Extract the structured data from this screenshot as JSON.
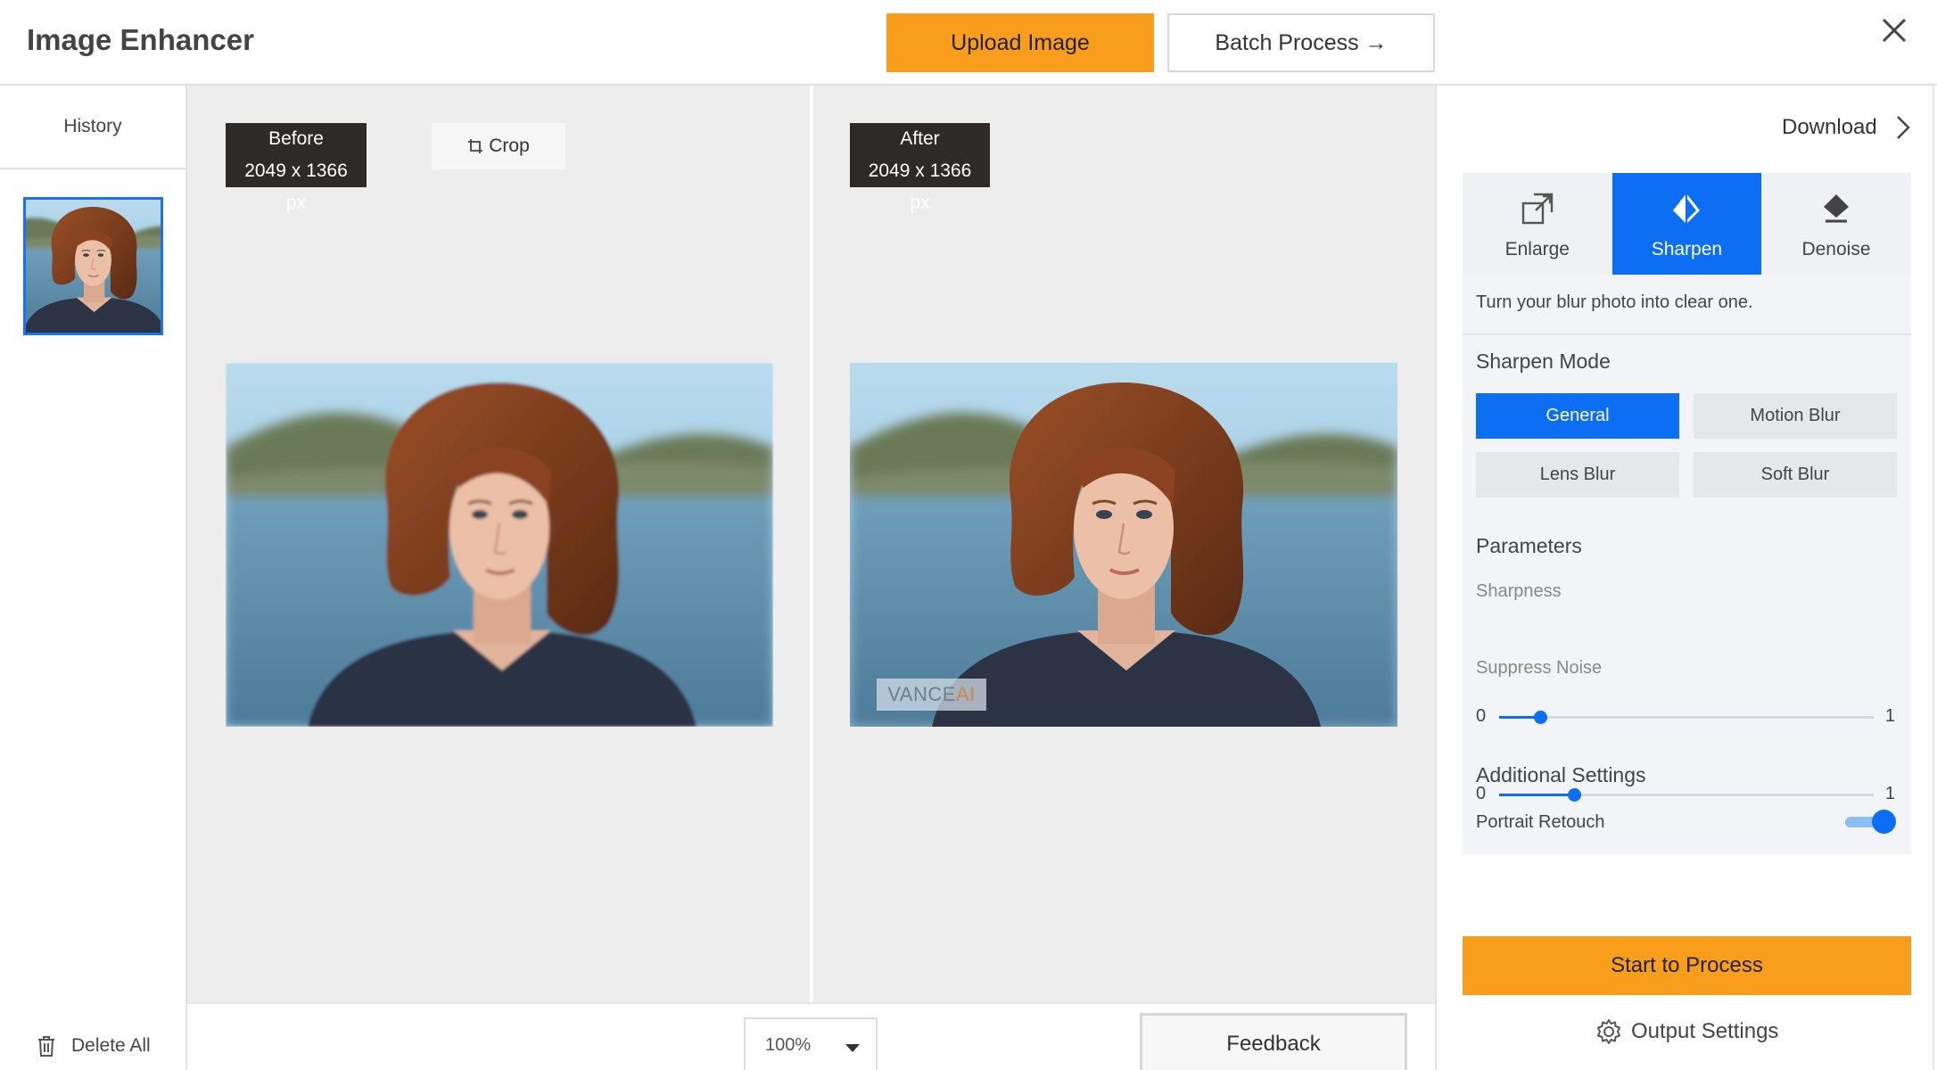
{
  "header": {
    "title": "Image Enhancer",
    "upload_label": "Upload Image",
    "batch_label": "Batch Process →"
  },
  "history": {
    "label": "History",
    "delete_all_label": "Delete All"
  },
  "canvas": {
    "before": {
      "label": "Before",
      "size": "2049 x 1366 px"
    },
    "after": {
      "label": "After",
      "size": "2049 x 1366 px"
    },
    "crop_label": "Crop",
    "watermark": {
      "main": "VANCE",
      "accent": "AI"
    }
  },
  "bottom": {
    "zoom": "100%",
    "feedback_label": "Feedback"
  },
  "right": {
    "download_label": "Download",
    "tabs": [
      {
        "label": "Enlarge",
        "icon": "enlarge-icon",
        "active": false
      },
      {
        "label": "Sharpen",
        "icon": "sharpen-icon",
        "active": true
      },
      {
        "label": "Denoise",
        "icon": "denoise-icon",
        "active": false
      }
    ],
    "description": "Turn your blur photo into clear one.",
    "sharpen_mode": {
      "title": "Sharpen Mode",
      "modes": [
        {
          "label": "General",
          "active": true
        },
        {
          "label": "Motion Blur",
          "active": false
        },
        {
          "label": "Lens Blur",
          "active": false
        },
        {
          "label": "Soft Blur",
          "active": false
        }
      ]
    },
    "parameters": {
      "title": "Parameters",
      "sharpness": {
        "label": "Sharpness",
        "min": "0",
        "max": "1",
        "value": 0.11
      },
      "suppress_noise": {
        "label": "Suppress Noise",
        "min": "0",
        "max": "1",
        "value": 0.2
      }
    },
    "additional": {
      "title": "Additional Settings",
      "portrait_retouch_label": "Portrait Retouch",
      "portrait_retouch_on": true
    },
    "start_label": "Start to Process",
    "output_settings_label": "Output Settings"
  },
  "colors": {
    "accent_orange": "#f99d1c",
    "accent_blue": "#0b6ef3"
  }
}
